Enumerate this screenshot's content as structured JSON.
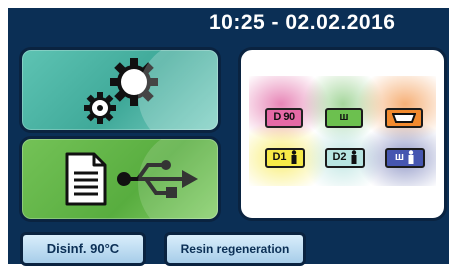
{
  "header": {
    "datetime": "10:25 - 02.02.2016"
  },
  "tiles": {
    "settings": {
      "icon": "gears-icon"
    },
    "export": {
      "document_icon": "document-icon",
      "usb_icon": "usb-icon"
    }
  },
  "programs": [
    {
      "label": "D 90",
      "color": "#d4247c",
      "icon": ""
    },
    {
      "label": "ш",
      "color": "#4cae3a",
      "icon": ""
    },
    {
      "label": "",
      "color": "#f07c1e",
      "icon": "tray-icon"
    },
    {
      "label": "D1",
      "color": "#f5e31a",
      "icon": "person-icon"
    },
    {
      "label": "D2",
      "color": "#9ad7d2",
      "icon": "person-icon"
    },
    {
      "label": "ш",
      "color": "#3d4a9c",
      "icon": "person-icon"
    }
  ],
  "bottom_buttons": {
    "disinfection": "Disinf. 90°C",
    "resin": "Resin regeneration"
  }
}
